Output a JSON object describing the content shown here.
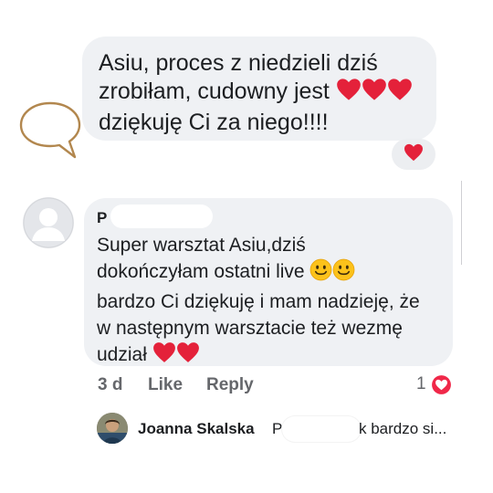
{
  "comment1": {
    "line1": "Asiu, proces z niedzieli dziś",
    "line2": "zrobiłam, cudowny jest",
    "line3": "dziękuję Ci za niego!!!!",
    "reaction": "heart"
  },
  "comment2": {
    "author_initial": "P",
    "line1": "Super warsztat Asiu,dziś",
    "line2": "dokończyłam ostatni live",
    "line3": "bardzo Ci dziękuję i mam nadzieję, że",
    "line4": "w następnym warsztacie też wezmę",
    "line5": "udział",
    "time": "3 d",
    "like_label": "Like",
    "reply_label": "Reply",
    "like_count": "1"
  },
  "reply": {
    "author": "Joanna Skalska",
    "prefix": "P",
    "snippet": "k bardzo si..."
  },
  "colors": {
    "bubble": "#eff1f4",
    "heart_red": "#e4213a",
    "meta_gray": "#65676b",
    "speech_outline": "#b2874e"
  }
}
